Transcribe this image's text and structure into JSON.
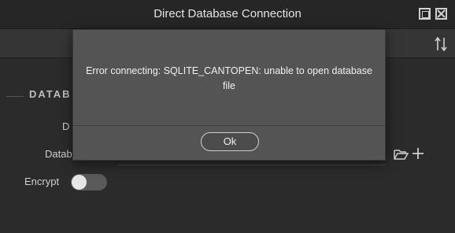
{
  "window": {
    "title": "Direct Database Connection",
    "maximize_icon": "maximize-icon",
    "close_icon": "close-icon"
  },
  "toolbar": {
    "sort_icon": "sort-arrows-icon"
  },
  "form": {
    "section_title": "DATAB",
    "field_d_label": "D",
    "database_label": "Datab",
    "encrypt_label": "Encrypt",
    "encrypt_enabled": false,
    "folder_icon": "folder-open-icon",
    "add_icon": "plus-icon"
  },
  "dialog": {
    "message": "Error connecting: SQLITE_CANTOPEN: unable to open database file",
    "ok_label": "Ok"
  },
  "colors": {
    "background": "#2b2b2b",
    "titlebar": "#262626",
    "dialog": "#545454"
  }
}
